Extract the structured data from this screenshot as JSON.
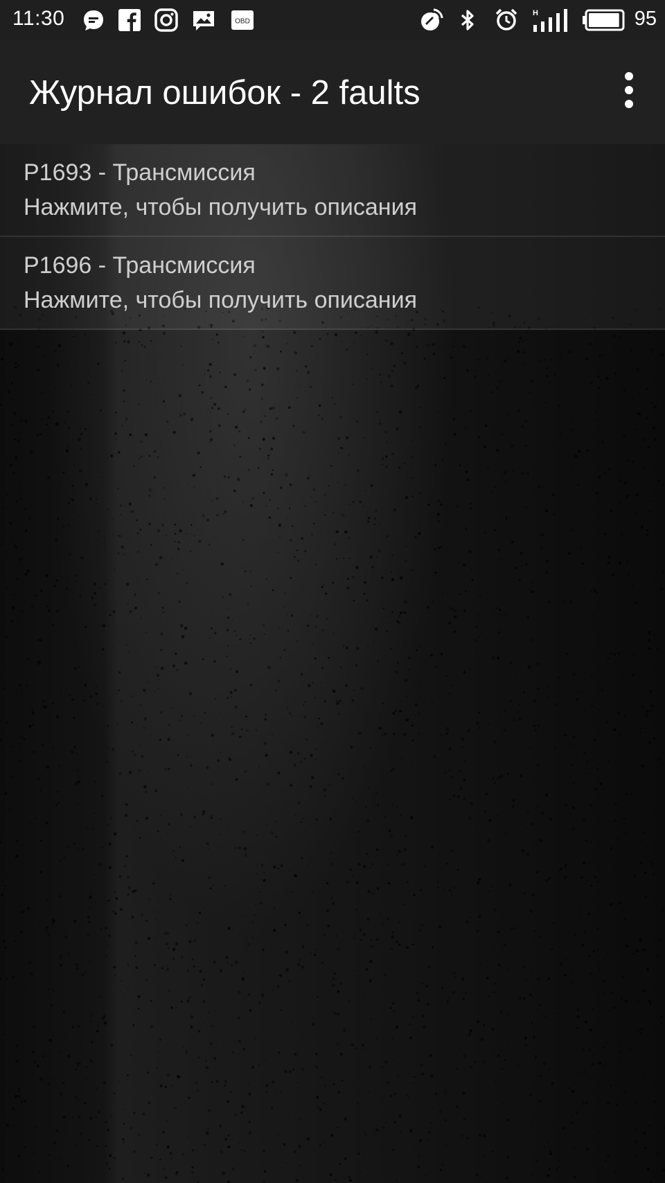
{
  "status_bar": {
    "time": "11:30",
    "notification_icons": [
      "chat-bubble-icon",
      "facebook-icon",
      "instagram-icon",
      "image-message-icon",
      "obd-icon"
    ],
    "obd_label": "OBD",
    "system_icons": [
      "location-off-icon",
      "bluetooth-icon",
      "alarm-icon",
      "signal-icon",
      "battery-icon"
    ],
    "signal_label": "H",
    "battery_percent": "95",
    "battery_level": 0.95
  },
  "app_bar": {
    "title": "Журнал ошибок - 2 faults",
    "menu_icon": "more-vert-icon"
  },
  "faults": [
    {
      "title": "P1693 - Трансмиссия",
      "subtitle": "Нажмите, чтобы получить описания"
    },
    {
      "title": "P1696 - Трансмиссия",
      "subtitle": "Нажмите, чтобы получить описания"
    }
  ],
  "colors": {
    "status_bar_bg": "#1f1f1f",
    "app_bar_bg": "#212121",
    "text_primary": "#ffffff",
    "list_text": "#cfcfcf"
  }
}
